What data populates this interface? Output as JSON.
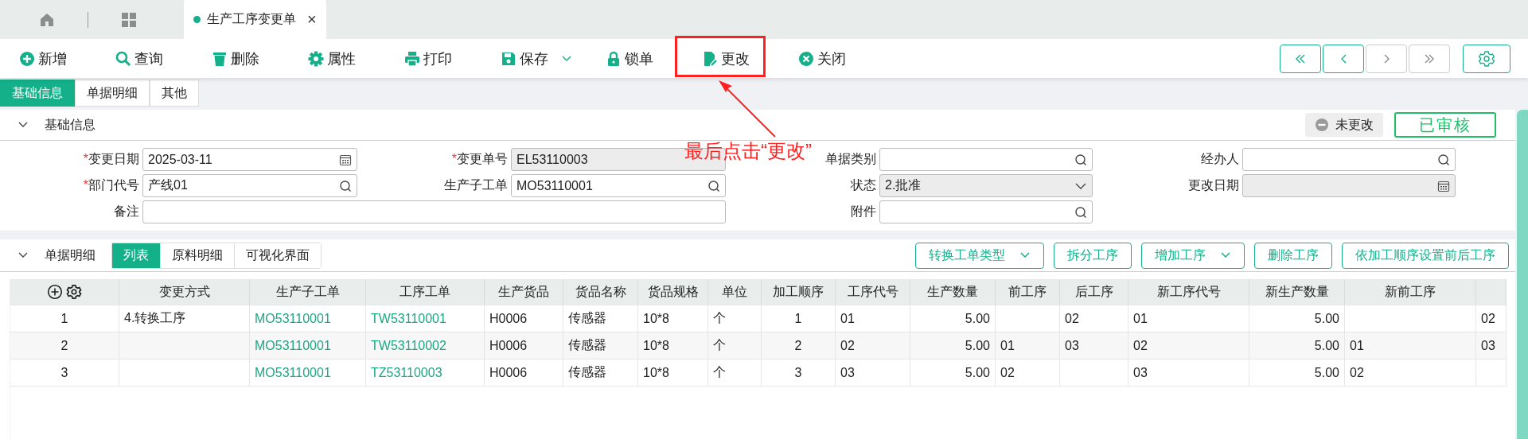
{
  "top_tabs": [
    {
      "kind": "home"
    },
    {
      "kind": "apps"
    },
    {
      "kind": "doc",
      "label": "生产工序变更单",
      "close": "×",
      "selected": true
    }
  ],
  "toolbar": [
    {
      "kind": "add",
      "label": "新增"
    },
    {
      "kind": "search",
      "label": "查询"
    },
    {
      "kind": "delete",
      "label": "删除"
    },
    {
      "kind": "settings",
      "label": "属性"
    },
    {
      "kind": "print",
      "label": "打印"
    },
    {
      "kind": "save",
      "label": "保存",
      "dropdown": true
    },
    {
      "kind": "lock",
      "label": "锁单"
    },
    {
      "kind": "edit",
      "label": "更改"
    },
    {
      "kind": "close",
      "label": "关闭"
    }
  ],
  "nav_buttons": [
    {
      "kind": "first",
      "disabled": false
    },
    {
      "kind": "prev",
      "disabled": false
    },
    {
      "kind": "next",
      "disabled": true
    },
    {
      "kind": "last",
      "disabled": true
    }
  ],
  "sub_tabs": [
    {
      "label": "基础信息",
      "selected": true
    },
    {
      "label": "单据明细",
      "selected": false
    },
    {
      "label": "其他",
      "selected": false
    }
  ],
  "basic_section": {
    "title": "基础信息",
    "expanded": true,
    "change_status": "未更改",
    "audit_stamp": "已审核",
    "fields": [
      {
        "label": "变更日期",
        "required_mark": "*",
        "value": "2025-03-11",
        "kind": "date",
        "disabled": false
      },
      {
        "label": "变更单号",
        "required_mark": "*",
        "value": "EL53110003",
        "kind": "text",
        "disabled": true
      },
      {
        "label": "单据类别",
        "kind": "lookup",
        "disabled": false
      },
      {
        "label": "经办人",
        "kind": "lookup",
        "disabled": false
      },
      {
        "label": "部门代号",
        "required_mark": "*",
        "value": "产线01",
        "kind": "lookup",
        "disabled": false
      },
      {
        "label": "生产子工单",
        "value": "MO53110001",
        "kind": "lookup",
        "disabled": false
      },
      {
        "label": "状态",
        "value": "2.批准",
        "kind": "select",
        "disabled": true
      },
      {
        "label": "更改日期",
        "kind": "date",
        "disabled": true
      },
      {
        "label": "备注",
        "kind": "text",
        "wide": true,
        "disabled": false
      },
      {
        "label": "附件",
        "kind": "lookup",
        "disabled": false
      }
    ]
  },
  "detail_section": {
    "title": "单据明细",
    "expanded": true,
    "view_tabs": [
      {
        "label": "列表",
        "selected": true
      },
      {
        "label": "原料明细",
        "selected": false
      },
      {
        "label": "可视化界面",
        "selected": false
      }
    ],
    "actions": [
      {
        "label": "转换工单类型",
        "dropdown": true
      },
      {
        "label": "拆分工序"
      },
      {
        "label": "增加工序",
        "dropdown": true
      },
      {
        "label": "删除工序"
      },
      {
        "label": "依加工顺序设置前后工序"
      }
    ]
  },
  "table": {
    "columns": [
      {
        "kind": "index"
      },
      {
        "label": "变更方式",
        "kind": "text"
      },
      {
        "label": "生产子工单",
        "kind": "link"
      },
      {
        "label": "工序工单",
        "kind": "link"
      },
      {
        "label": "生产货品",
        "kind": "text"
      },
      {
        "label": "货品名称",
        "kind": "text"
      },
      {
        "label": "货品规格",
        "kind": "text"
      },
      {
        "label": "单位",
        "kind": "text"
      },
      {
        "label": "加工顺序",
        "kind": "center"
      },
      {
        "label": "工序代号",
        "kind": "text"
      },
      {
        "label": "生产数量",
        "kind": "number"
      },
      {
        "label": "前工序",
        "kind": "text"
      },
      {
        "label": "后工序",
        "kind": "text"
      },
      {
        "label": "新工序代号",
        "kind": "text"
      },
      {
        "label": "新生产数量",
        "kind": "number"
      },
      {
        "label": "新前工序",
        "kind": "text"
      },
      {
        "kind": "text"
      }
    ],
    "rows": [
      [
        "1",
        "4.转换工序",
        "MO53110001",
        "TW53110001",
        "H0006",
        "传感器",
        "10*8",
        "个",
        "1",
        "01",
        "5.00",
        null,
        "02",
        "01",
        "5.00",
        null,
        "02"
      ],
      [
        "2",
        null,
        "MO53110001",
        "TW53110002",
        "H0006",
        "传感器",
        "10*8",
        "个",
        "2",
        "02",
        "5.00",
        "01",
        "03",
        "02",
        "5.00",
        "01",
        "03"
      ],
      [
        "3",
        null,
        "MO53110001",
        "TZ53110003",
        "H0006",
        "传感器",
        "10*8",
        "个",
        "3",
        "03",
        "5.00",
        "02",
        null,
        "03",
        "5.00",
        "02",
        null
      ]
    ]
  },
  "annotation": {
    "text": "最后点击“更改”"
  }
}
